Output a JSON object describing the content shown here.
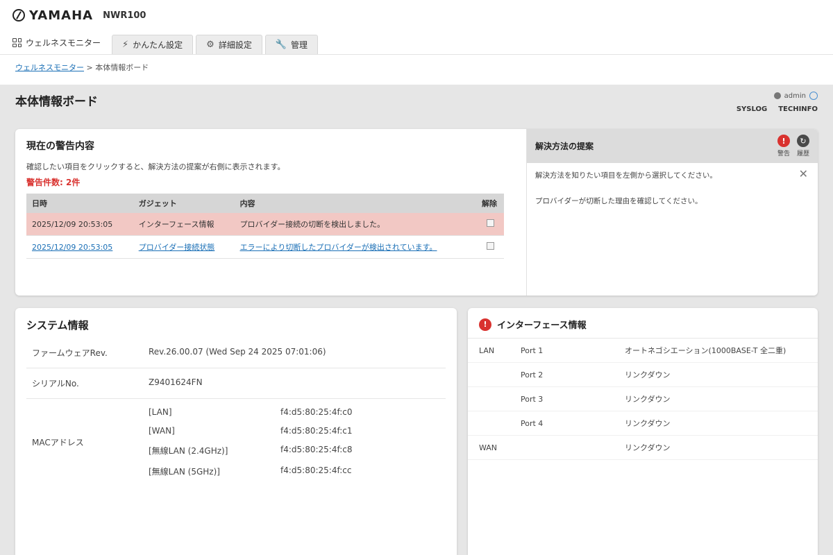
{
  "brand": {
    "logo_text": "YAMAHA",
    "product": "NWR100"
  },
  "nav": {
    "home_label": "ウェルネスモニター",
    "tabs": [
      {
        "label": "かんたん設定",
        "icon": "wand-icon"
      },
      {
        "label": "詳細設定",
        "icon": "gear-icon"
      },
      {
        "label": "管理",
        "icon": "wrench-icon"
      }
    ]
  },
  "breadcrumb": {
    "parent": "ウェルネスモニター",
    "separator": " > ",
    "current": "本体情報ボード"
  },
  "page": {
    "title": "本体情報ボード",
    "user": "admin",
    "links": [
      "SYSLOG",
      "TECHINFO"
    ]
  },
  "alerts": {
    "title": "現在の警告内容",
    "description": "確認したい項目をクリックすると、解決方法の提案が右側に表示されます。",
    "count_label": "警告件数: 2件",
    "columns": {
      "datetime": "日時",
      "gadget": "ガジェット",
      "content": "内容",
      "dismiss": "解除"
    },
    "rows": [
      {
        "datetime": "2025/12/09 20:53:05",
        "gadget": "インターフェース情報",
        "content": "プロバイダー接続の切断を検出しました。"
      },
      {
        "datetime": "2025/12/09 20:53:05",
        "gadget": "プロバイダー接続状態",
        "content": "エラーにより切断したプロバイダーが検出されています。"
      }
    ]
  },
  "solution": {
    "title": "解決方法の提案",
    "warning_label": "警告",
    "history_label": "履歴",
    "line1": "解決方法を知りたい項目を左側から選択してください。",
    "line2": "プロバイダーが切断した理由を確認してください。"
  },
  "system": {
    "title": "システム情報",
    "firmware_label": "ファームウェアRev.",
    "firmware_value": "Rev.26.00.07 (Wed Sep 24 2025 07:01:06)",
    "serial_label": "シリアルNo.",
    "serial_value": "Z9401624FN",
    "mac_label": "MACアドレス",
    "macs": [
      {
        "iface": "[LAN]",
        "addr": "f4:d5:80:25:4f:c0"
      },
      {
        "iface": "[WAN]",
        "addr": "f4:d5:80:25:4f:c1"
      },
      {
        "iface": "[無線LAN (2.4GHz)]",
        "addr": "f4:d5:80:25:4f:c8"
      },
      {
        "iface": "[無線LAN (5GHz)]",
        "addr": "f4:d5:80:25:4f:cc"
      }
    ]
  },
  "interfaces": {
    "title": "インターフェース情報",
    "rows": [
      {
        "group": "LAN",
        "port": "Port 1",
        "status": "オートネゴシエーション(1000BASE-T 全二重)"
      },
      {
        "group": "",
        "port": "Port 2",
        "status": "リンクダウン"
      },
      {
        "group": "",
        "port": "Port 3",
        "status": "リンクダウン"
      },
      {
        "group": "",
        "port": "Port 4",
        "status": "リンクダウン"
      },
      {
        "group": "WAN",
        "port": "",
        "status": "リンクダウン"
      }
    ]
  },
  "colors": {
    "alert_red": "#d9322f",
    "row_highlight": "#f2c8c4",
    "link_blue": "#1a6fb6"
  }
}
